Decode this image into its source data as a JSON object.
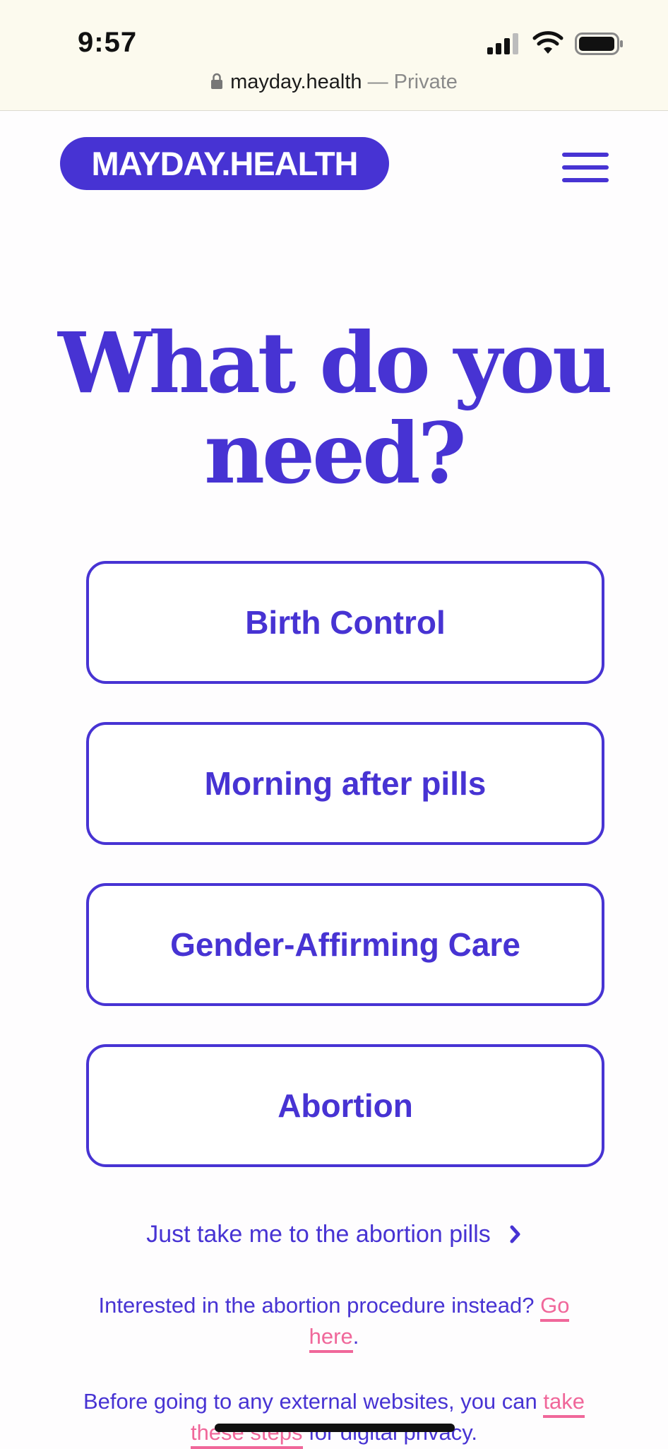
{
  "status_bar": {
    "time": "9:57",
    "url": "mayday.health",
    "mode": "— Private",
    "icons": [
      "signal-icon",
      "wifi-icon",
      "battery-icon",
      "lock-icon"
    ]
  },
  "header": {
    "logo_text": "MAYDAY.HEALTH",
    "menu_icon": "hamburger-menu-icon"
  },
  "heading": "What do you need?",
  "options": [
    {
      "label": "Birth Control"
    },
    {
      "label": "Morning after pills"
    },
    {
      "label": "Gender-Affirming Care"
    },
    {
      "label": "Abortion"
    }
  ],
  "pills_link": {
    "label": "Just take me to the abortion pills",
    "icon": "chevron-right-icon"
  },
  "procedure": {
    "text": "Interested in the abortion procedure instead?",
    "link": "Go here",
    "end": "."
  },
  "privacy": {
    "text": "Before going to any external websites, you can",
    "link": "take these steps",
    "end": "for digital privacy."
  },
  "colors": {
    "brand": "#4733d3",
    "link": "#f0679a",
    "status_bg": "#fcfaee",
    "page_bg": "#fefdfe"
  }
}
